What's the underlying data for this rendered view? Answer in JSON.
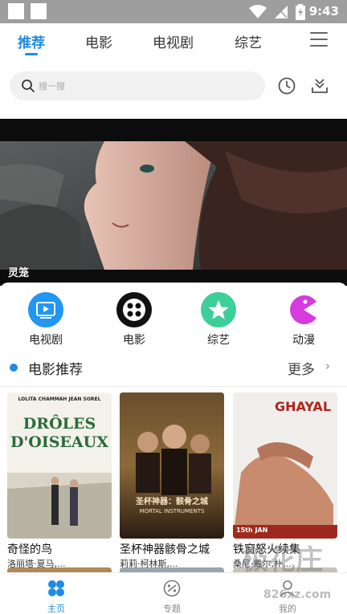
{
  "status": {
    "time": "9:43"
  },
  "tabs": [
    "推荐",
    "电影",
    "电视剧",
    "综艺"
  ],
  "search": {
    "placeholder": "搜一搜"
  },
  "banner": {
    "title": "灵笼"
  },
  "categories": [
    "电视剧",
    "电影",
    "综艺",
    "动漫"
  ],
  "section": {
    "title": "电影推荐",
    "more": "更多"
  },
  "movies": [
    {
      "title": "奇怪的鸟",
      "cast": "洛丽塔·夏马,...",
      "poster_text": [
        "LOLITA CHAMMAH  JEAN SOREL",
        "DRÔLES",
        "D'OISEAUX"
      ]
    },
    {
      "title": "圣杯神器骸骨之城",
      "cast": "莉莉·柯林斯,...",
      "poster_text": [
        "圣杯神器：骸骨之城",
        "MORTAL INSTRUMENTS"
      ]
    },
    {
      "title": "铁窗怒火续集",
      "cast": "桑尼·戴尔,朴...",
      "poster_text": [
        "GHAYAL",
        "15th JAN"
      ]
    }
  ],
  "bottom_nav": [
    "主页",
    "专题",
    "我的"
  ],
  "colors": {
    "accent": "#1f8ce6",
    "status_bar": "#9e9e9e"
  },
  "watermark": {
    "main": "极花庄",
    "sub": "826xz.com"
  }
}
